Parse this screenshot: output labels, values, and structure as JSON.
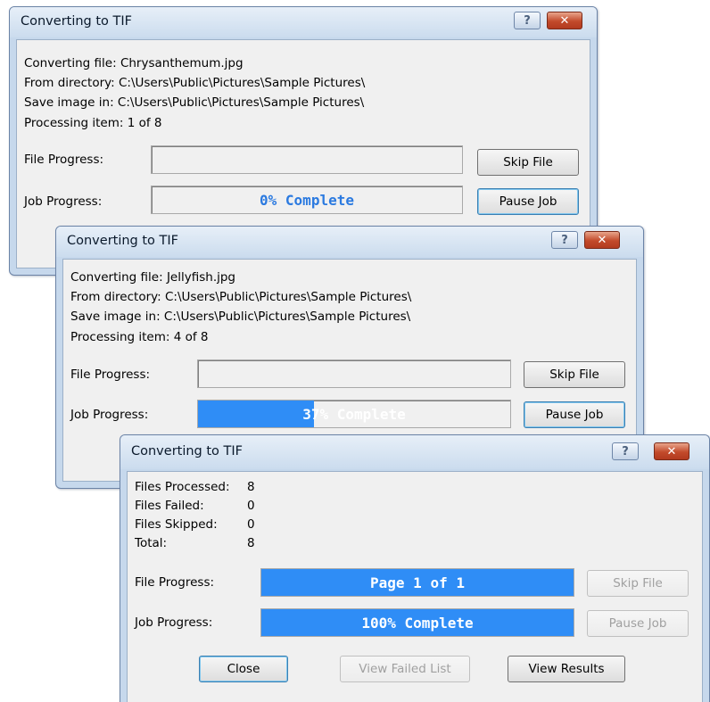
{
  "dialogs": [
    {
      "title": "Converting to TIF",
      "help_glyph": "?",
      "close_glyph": "✕",
      "info": [
        "Converting file: Chrysanthemum.jpg",
        "From directory: C:\\Users\\Public\\Pictures\\Sample Pictures\\",
        "Save image in: C:\\Users\\Public\\Pictures\\Sample Pictures\\",
        "Processing item: 1 of 8"
      ],
      "file_progress_label": "File Progress:",
      "job_progress_label": "Job Progress:",
      "file_progress_text": "",
      "file_progress_value": 0,
      "job_progress_text": "0% Complete",
      "job_progress_value": 0,
      "skip_file_label": "Skip File",
      "pause_job_label": "Pause Job"
    },
    {
      "title": "Converting to TIF",
      "help_glyph": "?",
      "close_glyph": "✕",
      "info": [
        "Converting file: Jellyfish.jpg",
        "From directory: C:\\Users\\Public\\Pictures\\Sample Pictures\\",
        "Save image in: C:\\Users\\Public\\Pictures\\Sample Pictures\\",
        "Processing item: 4 of 8"
      ],
      "file_progress_label": "File Progress:",
      "job_progress_label": "Job Progress:",
      "file_progress_text": "",
      "file_progress_value": 0,
      "job_progress_text": "37% Complete",
      "job_progress_value": 0.37,
      "skip_file_label": "Skip File",
      "pause_job_label": "Pause Job"
    },
    {
      "title": "Converting to TIF",
      "help_glyph": "?",
      "close_glyph": "✕",
      "stats": [
        {
          "key": "Files Processed:",
          "value": "8"
        },
        {
          "key": "Files Failed:",
          "value": "0"
        },
        {
          "key": "Files Skipped:",
          "value": "0"
        },
        {
          "key": "Total:",
          "value": "8"
        }
      ],
      "file_progress_label": "File Progress:",
      "job_progress_label": "Job Progress:",
      "file_progress_text": "Page 1 of 1",
      "file_progress_value": 1,
      "job_progress_text": "100% Complete",
      "job_progress_value": 1,
      "skip_file_label": "Skip File",
      "pause_job_label": "Pause Job",
      "close_label": "Close",
      "view_failed_label": "View Failed List",
      "view_results_label": "View Results"
    }
  ],
  "colors": {
    "progress_fill": "#2f8df6",
    "progress_text": "#2b7ae0",
    "close_button": "#c24a2b"
  }
}
